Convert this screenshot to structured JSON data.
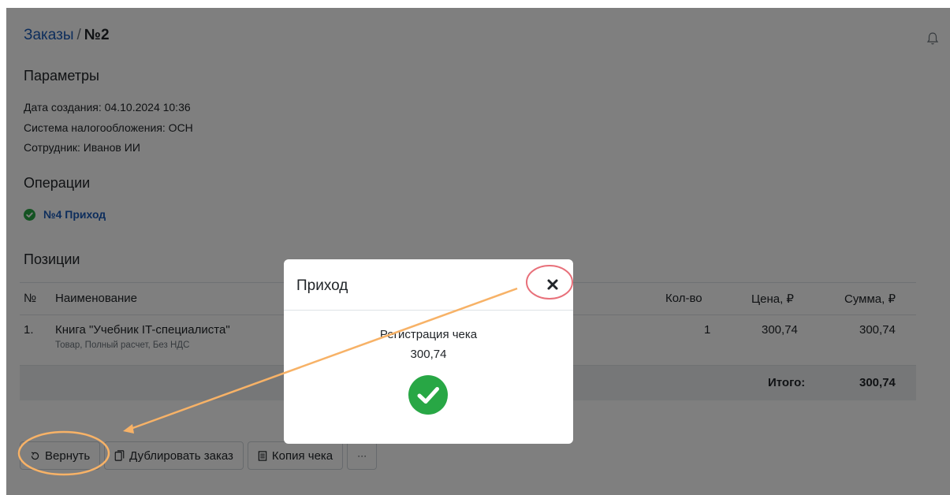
{
  "breadcrumb": {
    "parent": "Заказы",
    "separator": "/",
    "current": "№2"
  },
  "sections": {
    "params": "Параметры",
    "operations": "Операции",
    "positions": "Позиции"
  },
  "params": [
    "Дата создания: 04.10.2024 10:36",
    "Система налогообложения: ОСН",
    "Сотрудник: Иванов ИИ"
  ],
  "operation": {
    "label": "№4 Приход",
    "status": "success"
  },
  "table": {
    "headers": {
      "num": "№",
      "name": "Наименование",
      "qty": "Кол-во",
      "price": "Цена, ₽",
      "sum": "Сумма, ₽"
    },
    "rows": [
      {
        "num": "1.",
        "name": "Книга \"Учебник IT-специалиста\"",
        "details": "Товар, Полный расчет, Без НДС",
        "qty": "1",
        "price": "300,74",
        "sum": "300,74"
      }
    ],
    "total_label": "Итого:",
    "total_value": "300,74"
  },
  "actions": {
    "refund": "Вернуть",
    "duplicate": "Дублировать заказ",
    "receipt_copy": "Копия чека",
    "more": "···"
  },
  "modal": {
    "title": "Приход",
    "message": "Регистрация чека",
    "amount": "300,74",
    "close_icon": "close-icon",
    "status_icon": "check-circle-icon"
  },
  "colors": {
    "link": "#1a5bb8",
    "success": "#28a745",
    "annotation": "#f7b267",
    "highlight": "#e8707a"
  }
}
